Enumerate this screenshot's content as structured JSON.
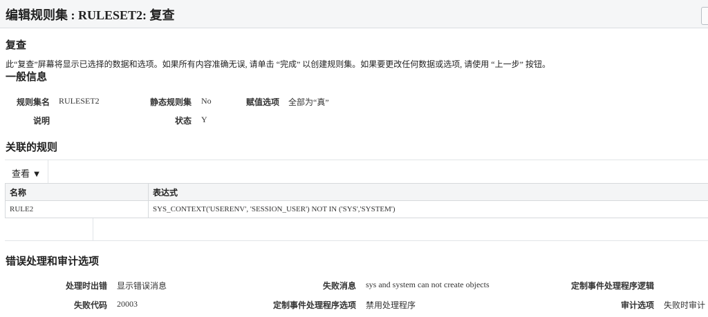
{
  "header": {
    "title": "编辑规则集 : RULESET2: 复查"
  },
  "review": {
    "heading": "复查",
    "description": "此“复查”屏幕将显示已选择的数据和选项。如果所有内容准确无误, 请单击 “完成” 以创建规则集。如果要更改任何数据或选项, 请使用 “上一步” 按钮。"
  },
  "general_info": {
    "heading": "一般信息",
    "rule_set_name_label": "规则集名",
    "rule_set_name_value": "RULESET2",
    "static_label": "静态规则集",
    "static_value": "No",
    "eval_option_label": "赋值选项",
    "eval_option_value": "全部为“真”",
    "description_label": "说明",
    "description_value": "",
    "status_label": "状态",
    "status_value": "Y"
  },
  "associated_rules": {
    "heading": "关联的规则",
    "view_menu_label": "查看 ▼",
    "columns": [
      "名称",
      "表达式"
    ],
    "rows": [
      {
        "name": "RULE2",
        "expression": "SYS_CONTEXT('USERENV', 'SESSION_USER') NOT IN ('SYS','SYSTEM')"
      }
    ]
  },
  "error_audit": {
    "heading": "错误处理和审计选项",
    "error_handling_label": "处理时出错",
    "error_handling_value": "显示错误消息",
    "fail_message_label": "失败消息",
    "fail_message_value": "sys and system can not create objects",
    "custom_logic_label": "定制事件处理程序逻辑",
    "custom_logic_value": "",
    "fail_code_label": "失败代码",
    "fail_code_value": "20003",
    "custom_option_label": "定制事件处理程序选项",
    "custom_option_value": "禁用处理程序",
    "audit_option_label": "审计选项",
    "audit_option_value": "失败时审计"
  }
}
